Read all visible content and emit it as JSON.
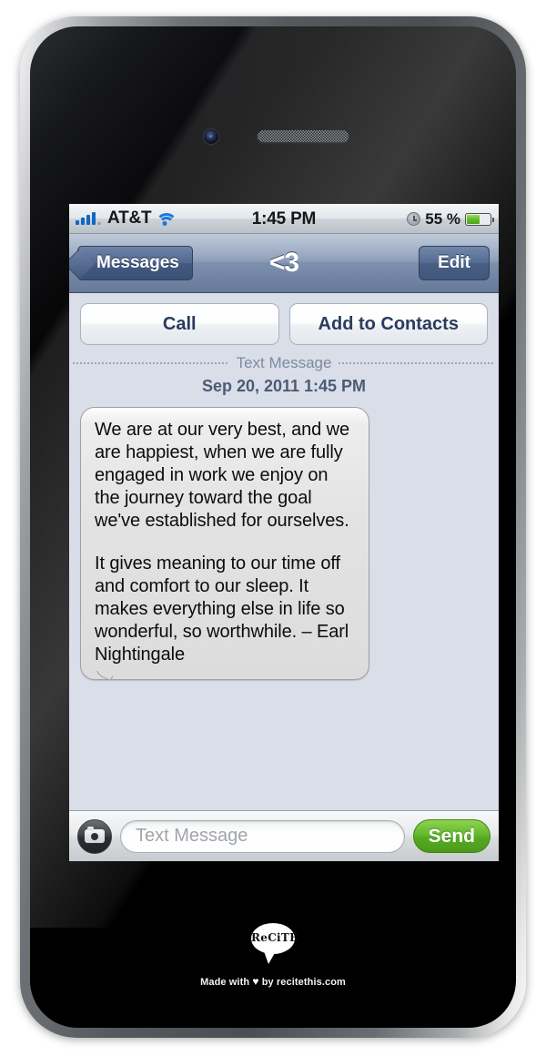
{
  "status_bar": {
    "signal_icon": "signal-bars-icon",
    "carrier": "AT&T",
    "wifi_icon": "wifi-icon",
    "time": "1:45 PM",
    "alarm_icon": "alarm-clock-icon",
    "battery_percent": "55 %",
    "battery_level": 55,
    "battery_icon": "battery-icon"
  },
  "nav_bar": {
    "back_label": "Messages",
    "title": "<3",
    "edit_label": "Edit"
  },
  "actions": {
    "call_label": "Call",
    "add_contact_label": "Add to Contacts"
  },
  "conversation": {
    "divider_label": "Text Message",
    "timestamp": "Sep 20, 2011 1:45 PM",
    "message": {
      "paragraph_1": "We are at our very best, and we are happiest, when we are fully engaged in work we enjoy on the journey toward the goal we've established for ourselves.",
      "paragraph_2": "It gives meaning to our time off and comfort to our sleep. It makes everything else in life so wonderful, so worthwhile. – Earl Nightingale"
    }
  },
  "compose": {
    "camera_icon": "camera-icon",
    "input_placeholder": "Text Message",
    "input_value": "",
    "send_label": "Send"
  },
  "brand": {
    "logo_text": "ReCiTE",
    "credit_prefix": "Made with",
    "credit_heart": "♥",
    "credit_suffix": "by recitethis.com"
  },
  "colors": {
    "chat_background": "#d9dee9",
    "nav_bar": "#7d90ad",
    "send_green": "#63b82c",
    "signal_blue": "#1168c4",
    "bubble_gray": "#e3e3e3"
  }
}
